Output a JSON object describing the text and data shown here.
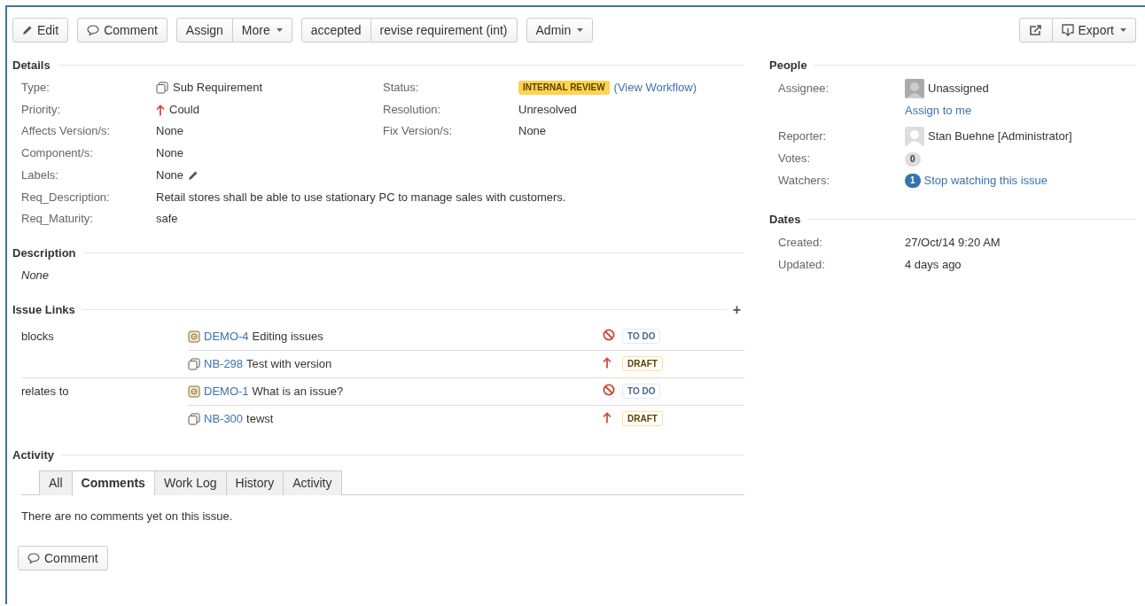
{
  "toolbar": {
    "groups": [
      [
        {
          "label": "Edit",
          "kind": "edit"
        }
      ],
      [
        {
          "label": "Comment",
          "kind": "comment"
        }
      ],
      [
        {
          "label": "Assign",
          "kind": "plain"
        },
        {
          "label": "More",
          "kind": "menu"
        }
      ],
      [
        {
          "label": "accepted",
          "kind": "plain"
        },
        {
          "label": "revise requirement (int)",
          "kind": "plain"
        }
      ],
      [
        {
          "label": "Admin",
          "kind": "menu"
        }
      ]
    ],
    "right_groups": [
      [
        {
          "kind": "share"
        },
        {
          "label": "Export",
          "kind": "export"
        }
      ]
    ]
  },
  "details": {
    "title": "Details",
    "rows": [
      [
        {
          "label": "Type:",
          "value": "Sub Requirement",
          "kind": "type"
        },
        {
          "label": "Status:",
          "value": "INTERNAL REVIEW",
          "link": "(View Workflow)",
          "kind": "status"
        }
      ],
      [
        {
          "label": "Priority:",
          "value": "Could",
          "kind": "priority"
        },
        {
          "label": "Resolution:",
          "value": "Unresolved",
          "kind": "plain"
        }
      ],
      [
        {
          "label": "Affects Version/s:",
          "value": "None",
          "kind": "plain"
        },
        {
          "label": "Fix Version/s:",
          "value": "None",
          "kind": "plain"
        }
      ],
      [
        {
          "label": "Component/s:",
          "value": "None",
          "kind": "plain"
        }
      ],
      [
        {
          "label": "Labels:",
          "value": "None",
          "kind": "labels"
        }
      ],
      [
        {
          "label": "Req_Description:",
          "value": "Retail stores shall be able to use stationary PC to manage sales with customers.",
          "kind": "plain"
        }
      ],
      [
        {
          "label": "Req_Maturity:",
          "value": "safe",
          "kind": "plain"
        }
      ]
    ]
  },
  "description": {
    "title": "Description",
    "text": "None"
  },
  "issue_links": {
    "title": "Issue Links",
    "add": "+",
    "groups": [
      {
        "relation": "blocks",
        "items": [
          {
            "key": "DEMO-4",
            "summary": "Editing issues",
            "kind": "task",
            "status": "TO DO"
          },
          {
            "key": "NB-298",
            "summary": "Test with version",
            "kind": "requirement",
            "status": "DRAFT"
          }
        ]
      },
      {
        "relation": "relates to",
        "items": [
          {
            "key": "DEMO-1",
            "summary": "What is an issue?",
            "kind": "task",
            "status": "TO DO"
          },
          {
            "key": "NB-300",
            "summary": "tewst",
            "kind": "requirement",
            "status": "DRAFT"
          }
        ]
      }
    ]
  },
  "activity": {
    "title": "Activity",
    "tabs": [
      {
        "label": "All",
        "selected": false
      },
      {
        "label": "Comments",
        "selected": true
      },
      {
        "label": "Work Log",
        "selected": false
      },
      {
        "label": "History",
        "selected": false
      },
      {
        "label": "Activity",
        "selected": false
      }
    ],
    "message": "There are no comments yet on this issue.",
    "button": "Comment"
  },
  "people": {
    "title": "People",
    "assignee": {
      "label": "Assignee:",
      "name": "Unassigned",
      "link": "Assign to me"
    },
    "reporter": {
      "label": "Reporter:",
      "name": "Stan Buehne [Administrator]"
    },
    "votes": {
      "label": "Votes:",
      "count": "0"
    },
    "watchers": {
      "label": "Watchers:",
      "count": "1",
      "link": "Stop watching this issue"
    }
  },
  "dates": {
    "title": "Dates",
    "rows": [
      {
        "label": "Created:",
        "value": "27/Oct/14 9:20 AM"
      },
      {
        "label": "Updated:",
        "value": "4 days ago"
      }
    ]
  }
}
